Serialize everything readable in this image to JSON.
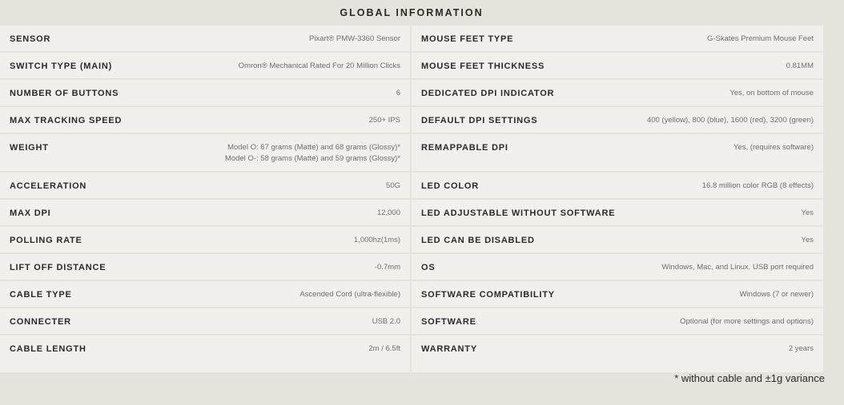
{
  "title": "GLOBAL INFORMATION",
  "left": [
    {
      "label": "SENSOR",
      "value": "Pixart® PMW-3360 Sensor"
    },
    {
      "label": "SWITCH TYPE (MAIN)",
      "value": "Omron® Mechanical Rated For 20 Million Clicks"
    },
    {
      "label": "NUMBER OF BUTTONS",
      "value": "6"
    },
    {
      "label": "MAX TRACKING SPEED",
      "value": "250+ IPS"
    },
    {
      "label": "WEIGHT",
      "value": "Model O: 67 grams (Matte) and 68 grams (Glossy)*",
      "value2": "Model O-: 58 grams (Matte) and 59 grams (Glossy)*"
    },
    {
      "label": "ACCELERATION",
      "value": "50G"
    },
    {
      "label": "MAX DPI",
      "value": "12,000"
    },
    {
      "label": "POLLING RATE",
      "value": "1,000hz(1ms)"
    },
    {
      "label": "LIFT OFF DISTANCE",
      "value": "-0.7mm"
    },
    {
      "label": "CABLE TYPE",
      "value": "Ascended Cord (ultra-flexible)"
    },
    {
      "label": "CONNECTER",
      "value": "USB 2.0"
    },
    {
      "label": "CABLE LENGTH",
      "value": "2m / 6.5ft"
    }
  ],
  "right": [
    {
      "label": "MOUSE FEET TYPE",
      "value": "G-Skates Premium Mouse Feet"
    },
    {
      "label": "MOUSE FEET THICKNESS",
      "value": "0.81MM"
    },
    {
      "label": "DEDICATED DPI INDICATOR",
      "value": "Yes, on bottom of mouse"
    },
    {
      "label": "DEFAULT DPI SETTINGS",
      "value": "400 (yellow), 800 (blue), 1600 (red), 3200 (green)"
    },
    {
      "label": "REMAPPABLE DPI",
      "value": "Yes, (requires software)"
    },
    {
      "label": "LED COLOR",
      "value": "16.8 million color RGB (8 effects)"
    },
    {
      "label": "LED ADJUSTABLE WITHOUT SOFTWARE",
      "value": "Yes"
    },
    {
      "label": "LED CAN BE DISABLED",
      "value": "Yes"
    },
    {
      "label": "OS",
      "value": "Windows, Mac, and Linux. USB port required"
    },
    {
      "label": "SOFTWARE COMPATIBILITY",
      "value": "Windows (7 or newer)"
    },
    {
      "label": "SOFTWARE",
      "value": "Optional (for more settings and options)"
    },
    {
      "label": "WARRANTY",
      "value": "2 years"
    }
  ],
  "footnote": "* without cable and ±1g variance"
}
